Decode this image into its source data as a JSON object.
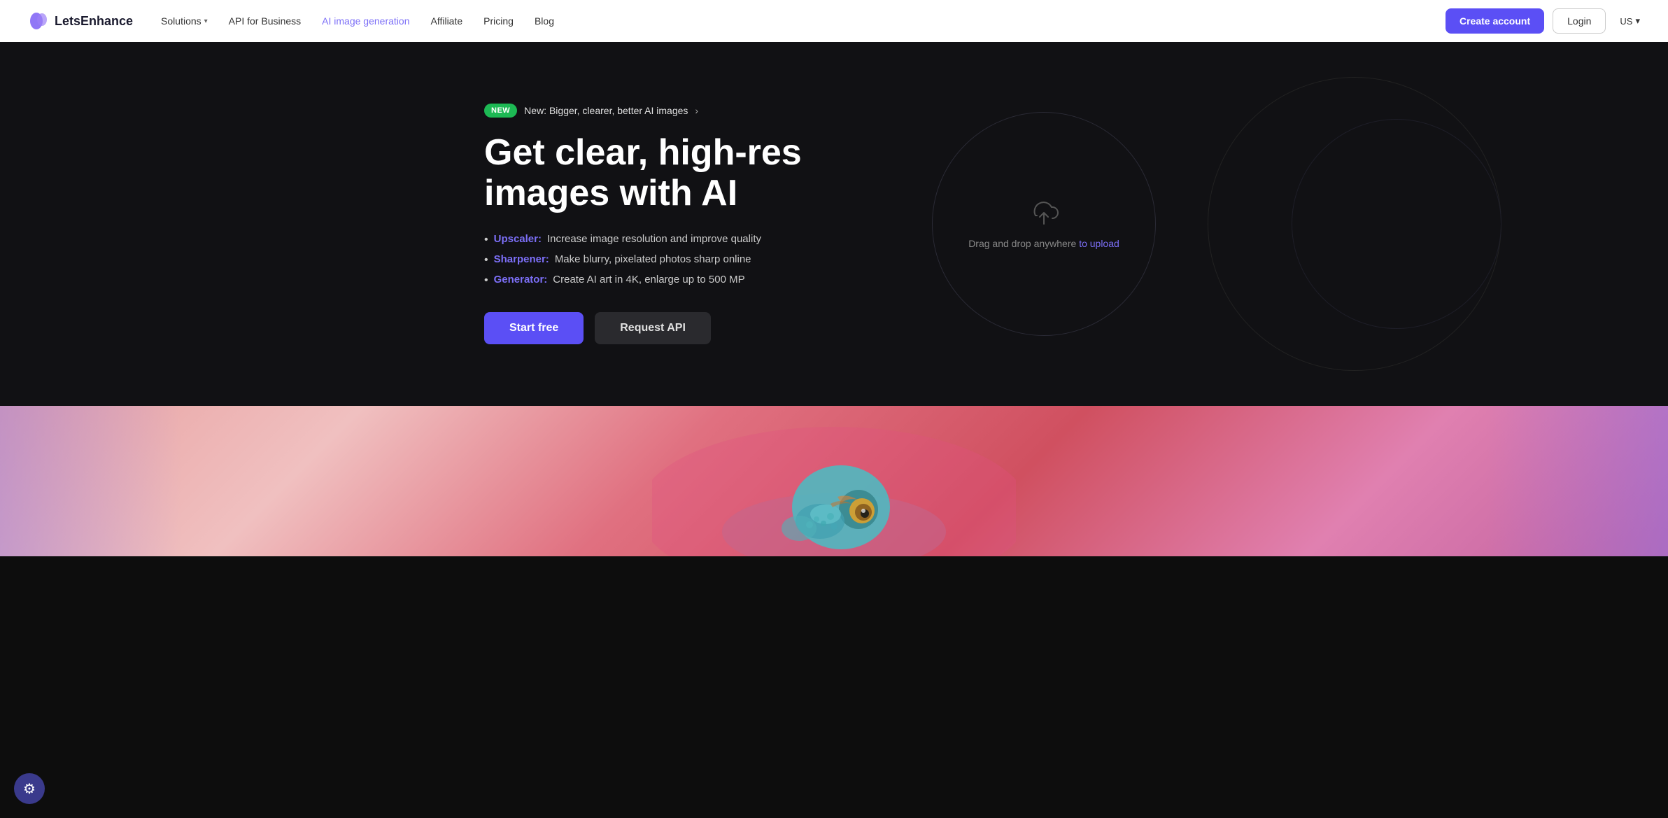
{
  "navbar": {
    "logo_text": "LetsEnhance",
    "nav_items": [
      {
        "id": "solutions",
        "label": "Solutions",
        "has_chevron": true,
        "active": false
      },
      {
        "id": "api",
        "label": "API for Business",
        "has_chevron": false,
        "active": false
      },
      {
        "id": "ai-image",
        "label": "AI image generation",
        "has_chevron": false,
        "active": true
      },
      {
        "id": "affiliate",
        "label": "Affiliate",
        "has_chevron": false,
        "active": false
      },
      {
        "id": "pricing",
        "label": "Pricing",
        "has_chevron": false,
        "active": false
      },
      {
        "id": "blog",
        "label": "Blog",
        "has_chevron": false,
        "active": false
      }
    ],
    "create_account_label": "Create account",
    "login_label": "Login",
    "lang_label": "US"
  },
  "hero": {
    "badge_label": "NEW",
    "badge_text": "New: Bigger, clearer, better AI images",
    "title": "Get clear, high-res images with AI",
    "features": [
      {
        "label": "Upscaler:",
        "text": "Increase image resolution and improve quality"
      },
      {
        "label": "Sharpener:",
        "text": "Make blurry, pixelated photos sharp online"
      },
      {
        "label": "Generator:",
        "text": "Create AI art in 4K, enlarge up to 500 MP"
      }
    ],
    "start_free_label": "Start free",
    "request_api_label": "Request API",
    "upload_text": "Drag and drop anywhere",
    "upload_link_text": "to upload",
    "colors": {
      "accent": "#5b4ff5",
      "feature_label": "#7c6ff7",
      "badge_bg": "#1db954",
      "upload_link": "#7c6ff7"
    }
  }
}
